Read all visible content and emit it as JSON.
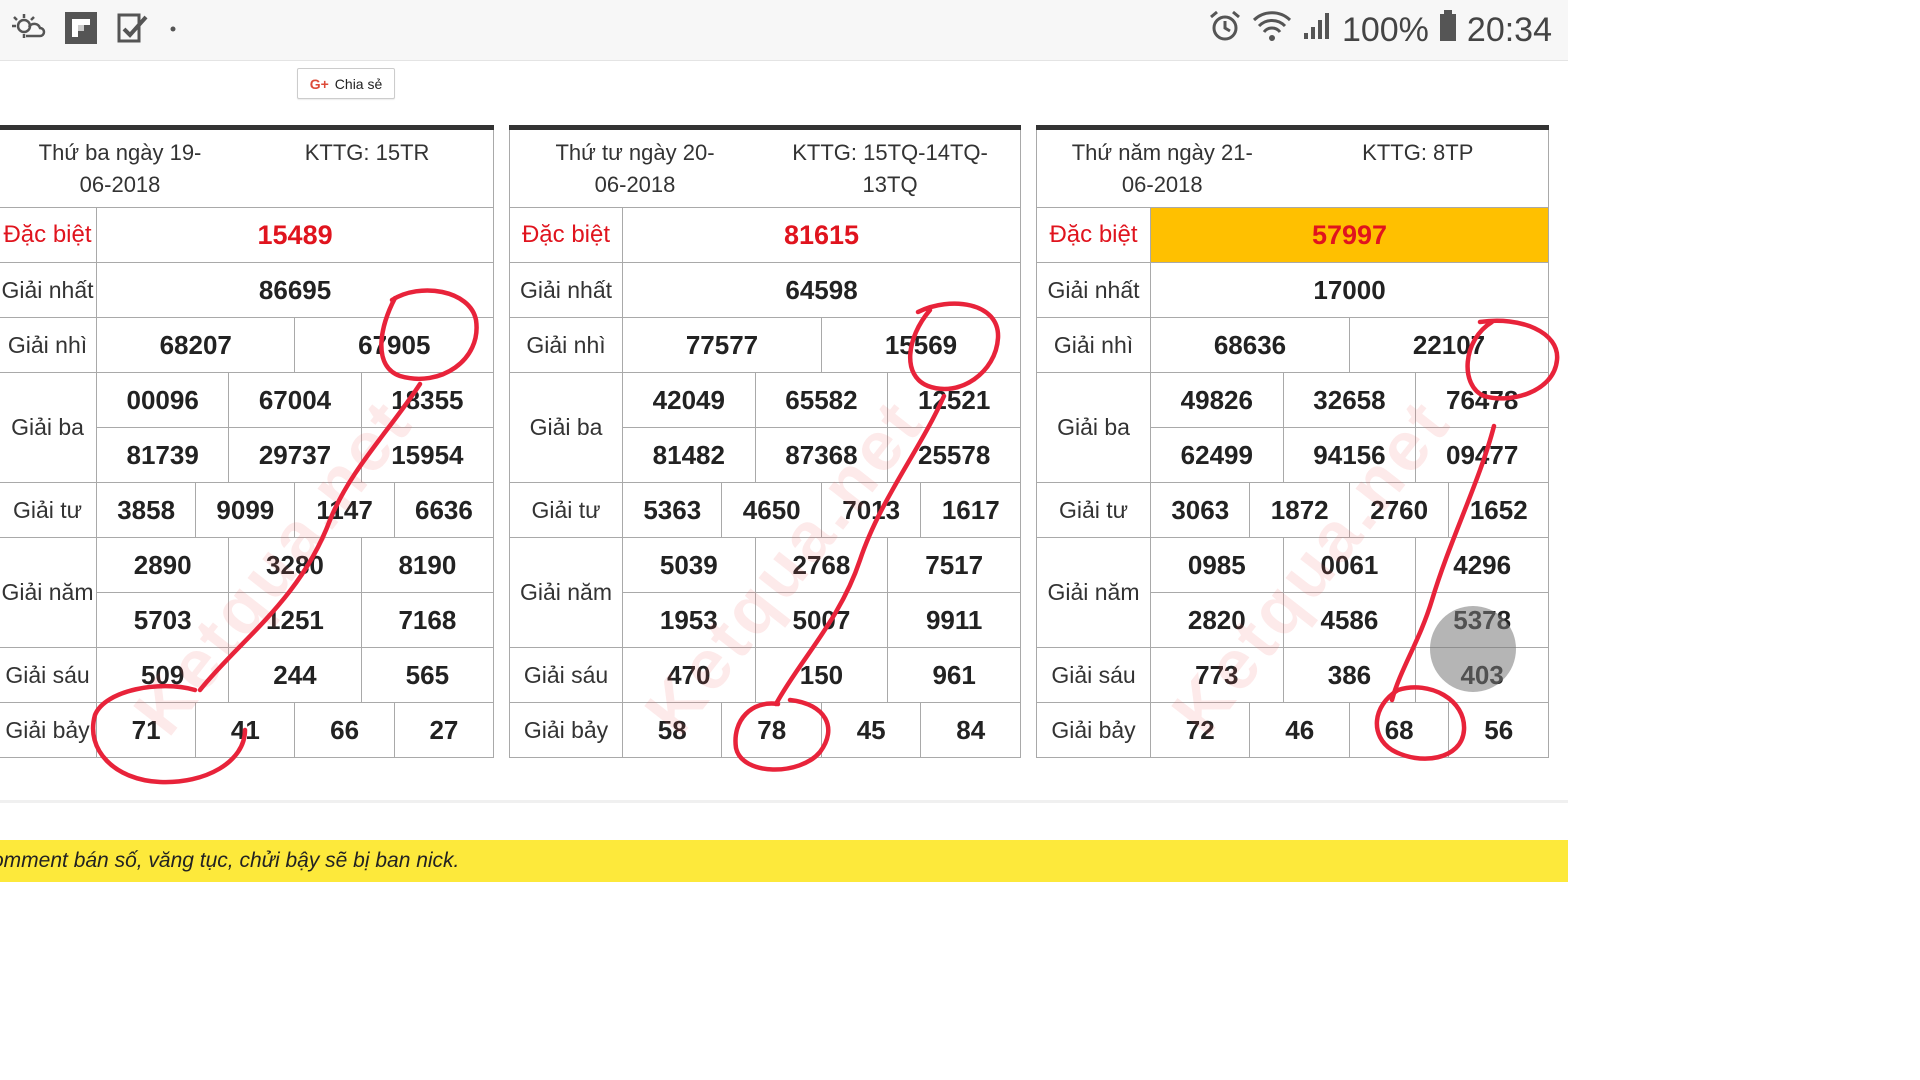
{
  "status_bar": {
    "battery_percent": "100%",
    "time": "20:34",
    "left_icons": [
      "weather-icon",
      "flipboard-icon",
      "tasks-check-icon",
      "dot-icon"
    ],
    "right_icons": [
      "alarm-icon",
      "wifi-icon",
      "signal-icon",
      "battery-icon"
    ]
  },
  "share": {
    "icon_text": "G+",
    "label": "Chia sẻ"
  },
  "tables": [
    {
      "header_date": "Thứ ba ngày 19-06-2018",
      "header_code": "KTTG: 15TR",
      "highlight_special": false,
      "labels": [
        "Đặc biệt",
        "Giải nhất",
        "Giải nhì",
        "Giải ba",
        "Giải tư",
        "Giải năm",
        "Giải sáu",
        "Giải bảy"
      ],
      "special": "15489",
      "first": "86695",
      "second": [
        "68207",
        "67905"
      ],
      "third": [
        [
          "00096",
          "67004",
          "18355"
        ],
        [
          "81739",
          "29737",
          "15954"
        ]
      ],
      "fourth": [
        "3858",
        "9099",
        "1147",
        "6636"
      ],
      "fifth": [
        [
          "2890",
          "3280",
          "8190"
        ],
        [
          "5703",
          "1251",
          "7168"
        ]
      ],
      "sixth": [
        "509",
        "244",
        "565"
      ],
      "seventh": [
        "71",
        "41",
        "66",
        "27"
      ]
    },
    {
      "header_date": "Thứ tư ngày 20-06-2018",
      "header_code": "KTTG: 15TQ-14TQ-13TQ",
      "highlight_special": false,
      "labels": [
        "Đặc biệt",
        "Giải nhất",
        "Giải nhì",
        "Giải ba",
        "Giải tư",
        "Giải năm",
        "Giải sáu",
        "Giải bảy"
      ],
      "special": "81615",
      "first": "64598",
      "second": [
        "77577",
        "15569"
      ],
      "third": [
        [
          "42049",
          "65582",
          "12521"
        ],
        [
          "81482",
          "87368",
          "25578"
        ]
      ],
      "fourth": [
        "5363",
        "4650",
        "7013",
        "1617"
      ],
      "fifth": [
        [
          "5039",
          "2768",
          "7517"
        ],
        [
          "1953",
          "5007",
          "9911"
        ]
      ],
      "sixth": [
        "470",
        "150",
        "961"
      ],
      "seventh": [
        "58",
        "78",
        "45",
        "84"
      ]
    },
    {
      "header_date": "Thứ năm ngày 21-06-2018",
      "header_code": "KTTG: 8TP",
      "highlight_special": true,
      "labels": [
        "Đặc biệt",
        "Giải nhất",
        "Giải nhì",
        "Giải ba",
        "Giải tư",
        "Giải năm",
        "Giải sáu",
        "Giải bảy"
      ],
      "special": "57997",
      "first": "17000",
      "second": [
        "68636",
        "22107"
      ],
      "third": [
        [
          "49826",
          "32658",
          "76478"
        ],
        [
          "62499",
          "94156",
          "09477"
        ]
      ],
      "fourth": [
        "3063",
        "1872",
        "2760",
        "1652"
      ],
      "fifth": [
        [
          "0985",
          "0061",
          "4296"
        ],
        [
          "2820",
          "4586",
          "5378"
        ]
      ],
      "sixth": [
        "773",
        "386",
        "403"
      ],
      "seventh": [
        "72",
        "46",
        "68",
        "56"
      ]
    }
  ],
  "watermark": "Ketqua.net",
  "colors": {
    "special_red": "#e0141e",
    "highlight_yellow": "#ffc000",
    "annotation_red": "#e8233a",
    "banner_yellow": "#fde93b"
  },
  "banner": {
    "text": "omment bán số, văng tục, chửi bậy sẽ bị ban nick."
  }
}
